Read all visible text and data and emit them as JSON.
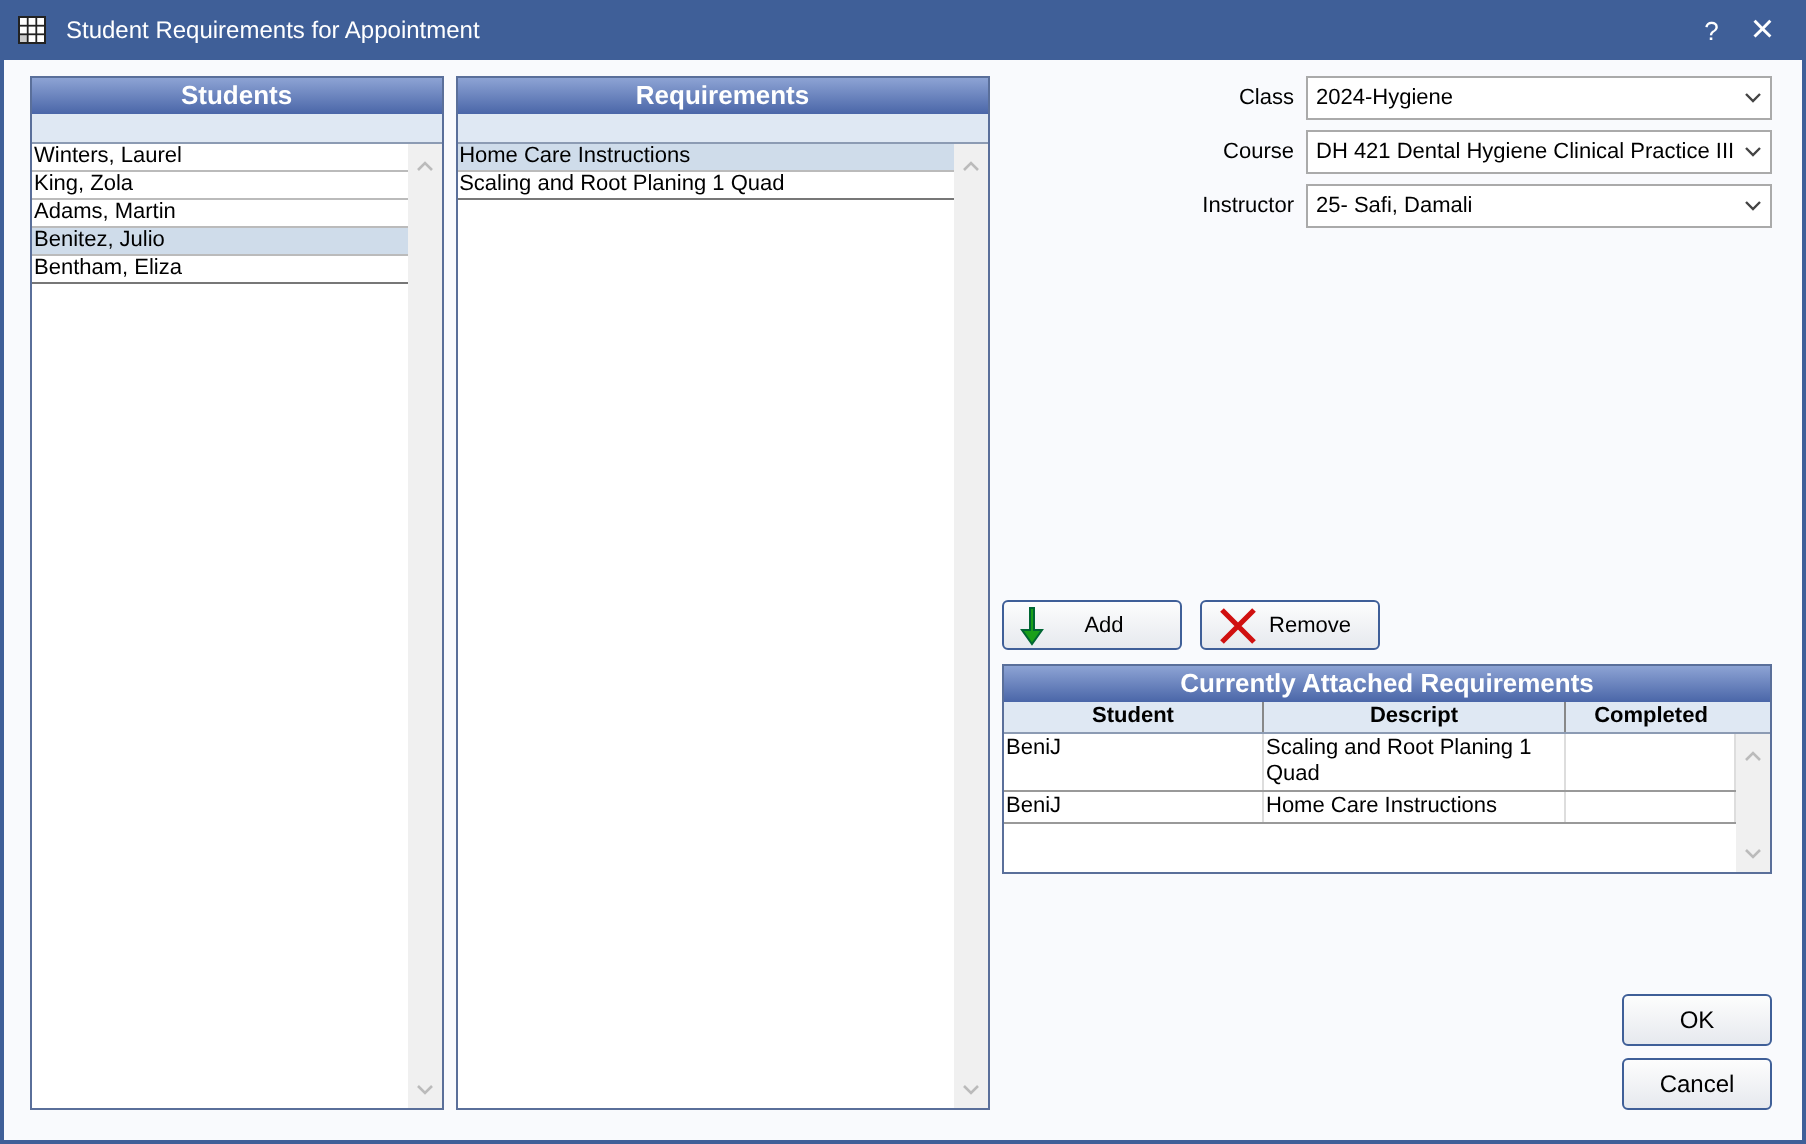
{
  "window": {
    "title": "Student Requirements for Appointment",
    "help_button": "?",
    "close_button": "×"
  },
  "students": {
    "title": "Students",
    "items": [
      {
        "name": "Winters, Laurel",
        "selected": false
      },
      {
        "name": "King, Zola",
        "selected": false
      },
      {
        "name": "Adams, Martin",
        "selected": false
      },
      {
        "name": "Benitez, Julio",
        "selected": true
      },
      {
        "name": "Bentham, Eliza",
        "selected": false
      }
    ]
  },
  "requirements": {
    "title": "Requirements",
    "items": [
      {
        "name": "Home Care Instructions",
        "selected": true
      },
      {
        "name": "Scaling and Root Planing 1 Quad",
        "selected": false
      }
    ]
  },
  "fields": [
    {
      "label": "Class",
      "value": "2024-Hygiene"
    },
    {
      "label": "Course",
      "value": "DH 421 Dental Hygiene Clinical Practice III"
    },
    {
      "label": "Instructor",
      "value": "25- Safi, Damali"
    }
  ],
  "add_button": "Add",
  "remove_button": "Remove",
  "attached": {
    "title": "Currently Attached Requirements",
    "columns": [
      "Student",
      "Descript",
      "Completed"
    ],
    "rows": [
      [
        "BeniJ",
        "Scaling and Root Planing 1 Quad",
        ""
      ],
      [
        "BeniJ",
        "Home Care Instructions",
        ""
      ]
    ]
  },
  "ok_button": "OK",
  "cancel_button": "Cancel"
}
